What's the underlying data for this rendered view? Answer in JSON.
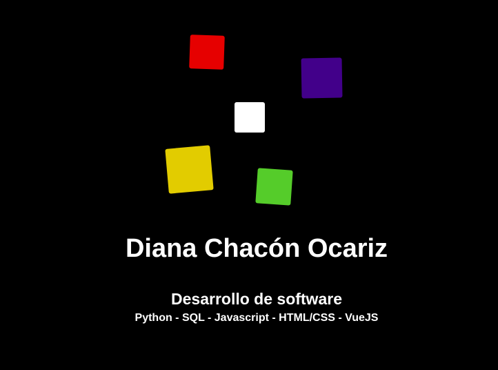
{
  "colors": {
    "background": "#000000",
    "text": "#ffffff",
    "squares": {
      "red": "#e60000",
      "purple": "#42008a",
      "white": "#ffffff",
      "yellow": "#e2cc00",
      "green": "#55cc2a"
    }
  },
  "profile": {
    "name": "Diana Chacón Ocariz",
    "role": "Desarrollo de software",
    "skills": "Python - SQL - Javascript - HTML/CSS - VueJS"
  }
}
